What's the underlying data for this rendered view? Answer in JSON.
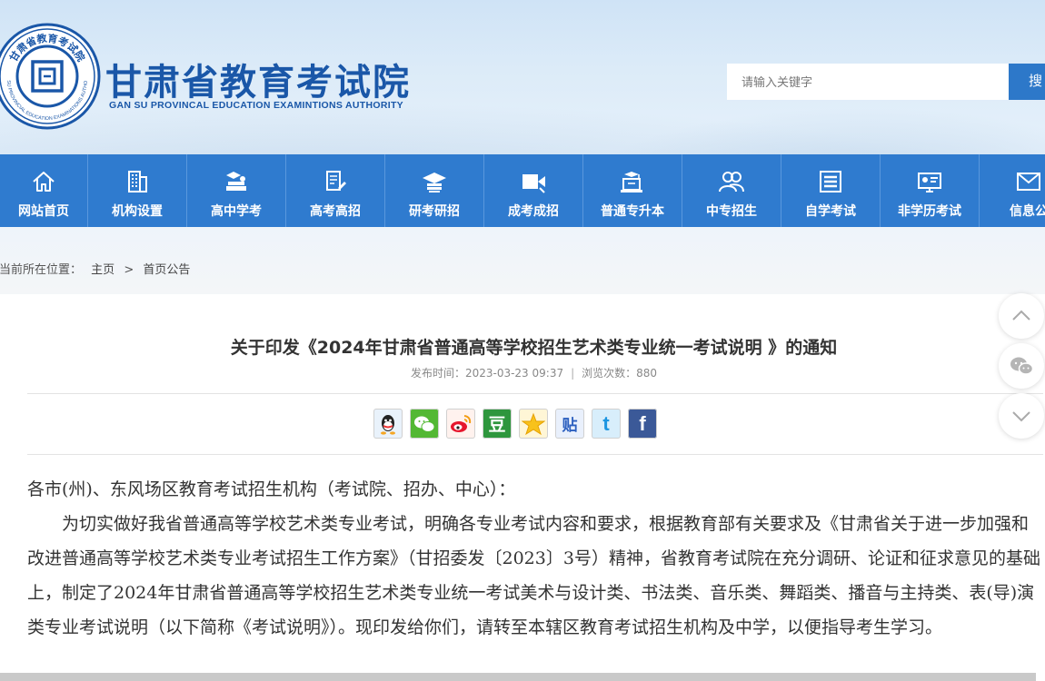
{
  "header": {
    "title": "甘肃省教育考试院",
    "subtitle": "GAN SU PROVINCAL EDUCATION EXAMINTIONS AUTHORITY",
    "seal_text": "甘肃省教育考试院",
    "seal_ring_text": "GANSU PROVINCIAL EDUCATION EXAMINATIONS AUTHORITY",
    "search_placeholder": "请输入关键字",
    "search_button": "搜"
  },
  "nav": {
    "items": [
      {
        "label": "网站首页",
        "icon": "home-icon"
      },
      {
        "label": "机构设置",
        "icon": "building-icon"
      },
      {
        "label": "高中学考",
        "icon": "books-icon"
      },
      {
        "label": "高考高招",
        "icon": "document-pen-icon"
      },
      {
        "label": "研考研招",
        "icon": "graduation-cap-icon"
      },
      {
        "label": "成考成招",
        "icon": "video-icon"
      },
      {
        "label": "普通专升本",
        "icon": "laptop-cap-icon"
      },
      {
        "label": "中专招生",
        "icon": "users-icon"
      },
      {
        "label": "自学考试",
        "icon": "list-icon"
      },
      {
        "label": "非学历考试",
        "icon": "id-card-icon"
      },
      {
        "label": "信息公",
        "icon": "mail-icon"
      }
    ]
  },
  "breadcrumb": {
    "prefix": "您当前所在位置：",
    "home": "主页",
    "separator": ">",
    "current": "首页公告"
  },
  "article": {
    "title": "关于印发《2024年甘肃省普通高等学校招生艺术类专业统一考试说明 》的通知",
    "publish_label": "发布时间：",
    "publish_time": "2023-03-23 09:37",
    "meta_sep": "|",
    "views_label": "浏览次数：",
    "views": "880",
    "salutation": "各市(州)、东风场区教育考试招生机构（考试院、招办、中心）：",
    "paragraph": "为切实做好我省普通高等学校艺术类专业考试，明确各专业考试内容和要求，根据教育部有关要求及《甘肃省关于进一步加强和改进普通高等学校艺术类专业考试招生工作方案》（甘招委发〔2023〕3号）精神，省教育考试院在充分调研、论证和征求意见的基础上，制定了2024年甘肃省普通高等学校招生艺术类专业统一考试美术与设计类、书法类、音乐类、舞蹈类、播音与主持类、表(导)演类专业考试说明（以下简称《考试说明》）。现印发给你们，请转至本辖区教育考试招生机构及中学，以便指导考生学习。"
  },
  "share": {
    "items": [
      "qq-icon",
      "wechat-icon",
      "weibo-icon",
      "douban-icon",
      "qzone-icon",
      "tieba-icon",
      "twitter-icon",
      "facebook-icon"
    ],
    "labels": {
      "douban": "豆",
      "tieba": "贴"
    }
  },
  "colors": {
    "brand_blue": "#2f7bcf",
    "title_blue": "#1a57a8"
  }
}
